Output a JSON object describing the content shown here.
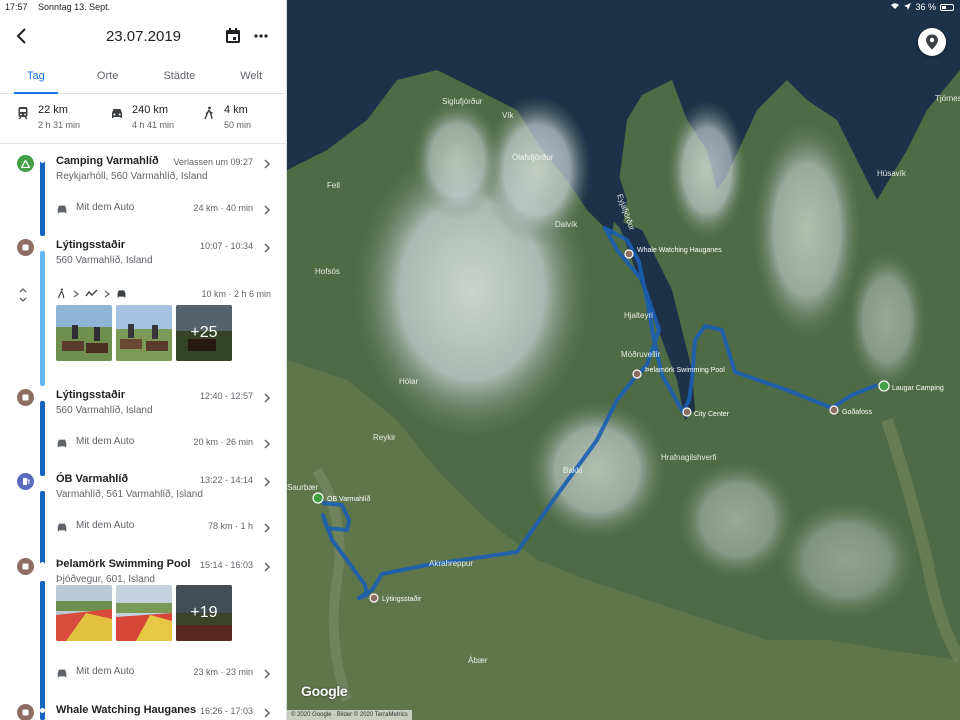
{
  "status_bar": {
    "time": "17:57",
    "date": "Sonntag 13. Sept.",
    "battery": "36 %",
    "battery_level": 0.36
  },
  "header": {
    "date": "23.07.2019"
  },
  "tabs": [
    {
      "label": "Tag",
      "active": true
    },
    {
      "label": "Orte",
      "active": false
    },
    {
      "label": "Städte",
      "active": false
    },
    {
      "label": "Welt",
      "active": false
    }
  ],
  "summary": [
    {
      "icon": "train-icon",
      "distance": "22 km",
      "duration": "2 h 31 min"
    },
    {
      "icon": "car-icon",
      "distance": "240 km",
      "duration": "4 h 41 min"
    },
    {
      "icon": "walk-icon",
      "distance": "4 km",
      "duration": "50 min"
    }
  ],
  "timeline": {
    "places": [
      {
        "name": "Camping Varmahlíð",
        "time": "Verlassen um 09:27",
        "address": "Reykjarhóll, 560 Varmahlíð, Island",
        "icon": "campground-icon",
        "color": "#43a047"
      },
      {
        "name": "Lýtingsstaðir",
        "time": "10:07 - 10:34",
        "address": "560 Varmahlíð, Island",
        "icon": "place-icon",
        "color": "#8d6e63"
      },
      {
        "name": "Lýtingsstaðir",
        "time": "12:40 - 12:57",
        "address": "560 Varmahlíð, Island",
        "icon": "place-icon",
        "color": "#8d6e63"
      },
      {
        "name": "ÓB Varmahlíð",
        "time": "13:22 - 14:14",
        "address": "Varmahlíð, 561 Varmahlíð, Island",
        "icon": "gas-station-icon",
        "color": "#5c6bc0"
      },
      {
        "name": "Þelamörk Swimming Pool",
        "time": "15:14 - 16:03",
        "address": "Þjóðvegur, 601, Island",
        "icon": "place-icon",
        "color": "#8d6e63"
      },
      {
        "name": "Whale Watching Hauganes",
        "time": "16:26 - 17:03",
        "address": "",
        "icon": "place-icon",
        "color": "#8d6e63"
      }
    ],
    "moves": [
      {
        "label": "Mit dem Auto",
        "distance": "24 km · 40 min"
      },
      {
        "label": "Mit dem Auto",
        "distance": "20 km · 26 min"
      },
      {
        "label": "Mit dem Auto",
        "distance": "78 km · 1 h"
      },
      {
        "label": "Mit dem Auto",
        "distance": "23 km · 23 min"
      }
    ],
    "multi_segment": {
      "distance": "10 km · 2 h 6 min"
    },
    "photo_groups": [
      {
        "more": "+25"
      },
      {
        "more": "+19"
      }
    ]
  },
  "map": {
    "places": [
      "Siglufjörður",
      "Vík",
      "Ólafsfjörður",
      "Dalvík",
      "Eyjafjörður",
      "Hofsós",
      "Fell",
      "Hjalteyri",
      "Möðruvellir",
      "Hólar",
      "Reykir",
      "Bakki",
      "Hrafnagilshverfi",
      "Akrahreppur",
      "Ábær",
      "Húsavík",
      "Tjörnes",
      "Saurbær"
    ],
    "pois": [
      {
        "name": "Whale Watching Hauganes",
        "type": "place"
      },
      {
        "name": "Þelamörk Swimming Pool",
        "type": "place"
      },
      {
        "name": "City Center",
        "type": "place"
      },
      {
        "name": "Goðafoss",
        "type": "place"
      },
      {
        "name": "Laugar Camping",
        "type": "campground"
      },
      {
        "name": "ÓB Varmahlíð",
        "type": "campground"
      },
      {
        "name": "Lýtingsstaðir",
        "type": "place"
      }
    ],
    "google_logo": "Google",
    "attribution": "© 2020 Google · Bilder © 2020 TerraMetrics"
  }
}
